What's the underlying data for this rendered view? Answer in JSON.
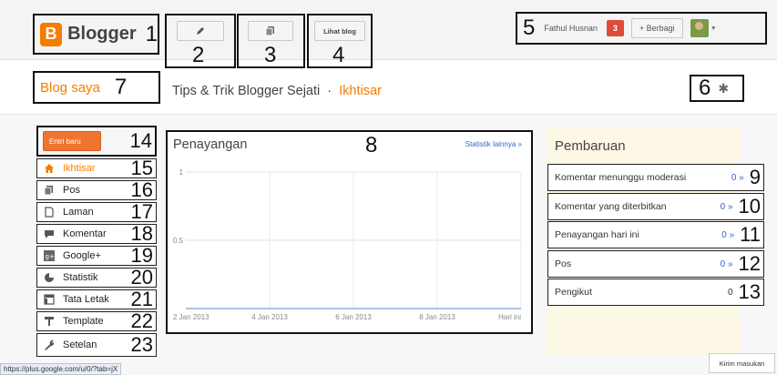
{
  "app": {
    "logo_text": "Blogger",
    "logo_letter": "B",
    "colors": {
      "brand": "#f57d00",
      "count_badge": "#dd4b39",
      "link": "#3366cc"
    }
  },
  "header": {
    "user_name": "Fathul Husnan",
    "notifications_count": "3",
    "share_label": "+ Berbagi",
    "view_blog_label": "Lihat blog"
  },
  "subheader": {
    "blog_link": "Blog saya",
    "blog_title": "Tips & Trik Blogger Sejati",
    "separator": "·",
    "section": "Ikhtisar"
  },
  "sidebar": {
    "new_post": "Entri baru",
    "items": [
      {
        "label": "Ikhtisar",
        "icon": "home-icon",
        "active": true,
        "num": "15"
      },
      {
        "label": "Pos",
        "icon": "posts-icon",
        "num": "16"
      },
      {
        "label": "Laman",
        "icon": "page-icon",
        "num": "17"
      },
      {
        "label": "Komentar",
        "icon": "comment-icon",
        "num": "18"
      },
      {
        "label": "Google+",
        "icon": "google-plus-icon",
        "num": "19"
      },
      {
        "label": "Statistik",
        "icon": "stats-icon",
        "num": "20"
      },
      {
        "label": "Tata Letak",
        "icon": "layout-icon",
        "num": "21"
      },
      {
        "label": "Template",
        "icon": "template-icon",
        "num": "22"
      },
      {
        "label": "Setelan",
        "icon": "wrench-icon",
        "num": "23"
      }
    ]
  },
  "stats": {
    "title": "Penayangan",
    "more_link": "Statistik lainnya »"
  },
  "chart_data": {
    "type": "line",
    "x": [
      "2 Jan 2013",
      "4 Jan 2013",
      "6 Jan 2013",
      "8 Jan 2013",
      "Hari ini"
    ],
    "series": [
      {
        "values": [
          0,
          0,
          0,
          0,
          0
        ]
      }
    ],
    "yticks": [
      "1",
      "0.5"
    ],
    "ylim": [
      0,
      1
    ],
    "grid": true
  },
  "updates": {
    "title": "Pembaruan",
    "rows": [
      {
        "label": "Komentar menunggu moderasi",
        "count": "0 »",
        "num": "9"
      },
      {
        "label": "Komentar yang diterbitkan",
        "count": "0 »",
        "num": "10"
      },
      {
        "label": "Penayangan hari ini",
        "count": "0 »",
        "num": "11"
      },
      {
        "label": "Pos",
        "count": "0 »",
        "num": "12"
      },
      {
        "label": "Pengikut",
        "count": "0",
        "num": "13"
      }
    ]
  },
  "callouts": {
    "n1": "1",
    "n2": "2",
    "n3": "3",
    "n4": "4",
    "n5": "5",
    "n6": "6",
    "n7": "7",
    "n8": "8",
    "n14": "14"
  },
  "footer": {
    "status_url": "https://plus.google.com/u/0/?tab=jX",
    "feedback": "Kirim masukan"
  }
}
